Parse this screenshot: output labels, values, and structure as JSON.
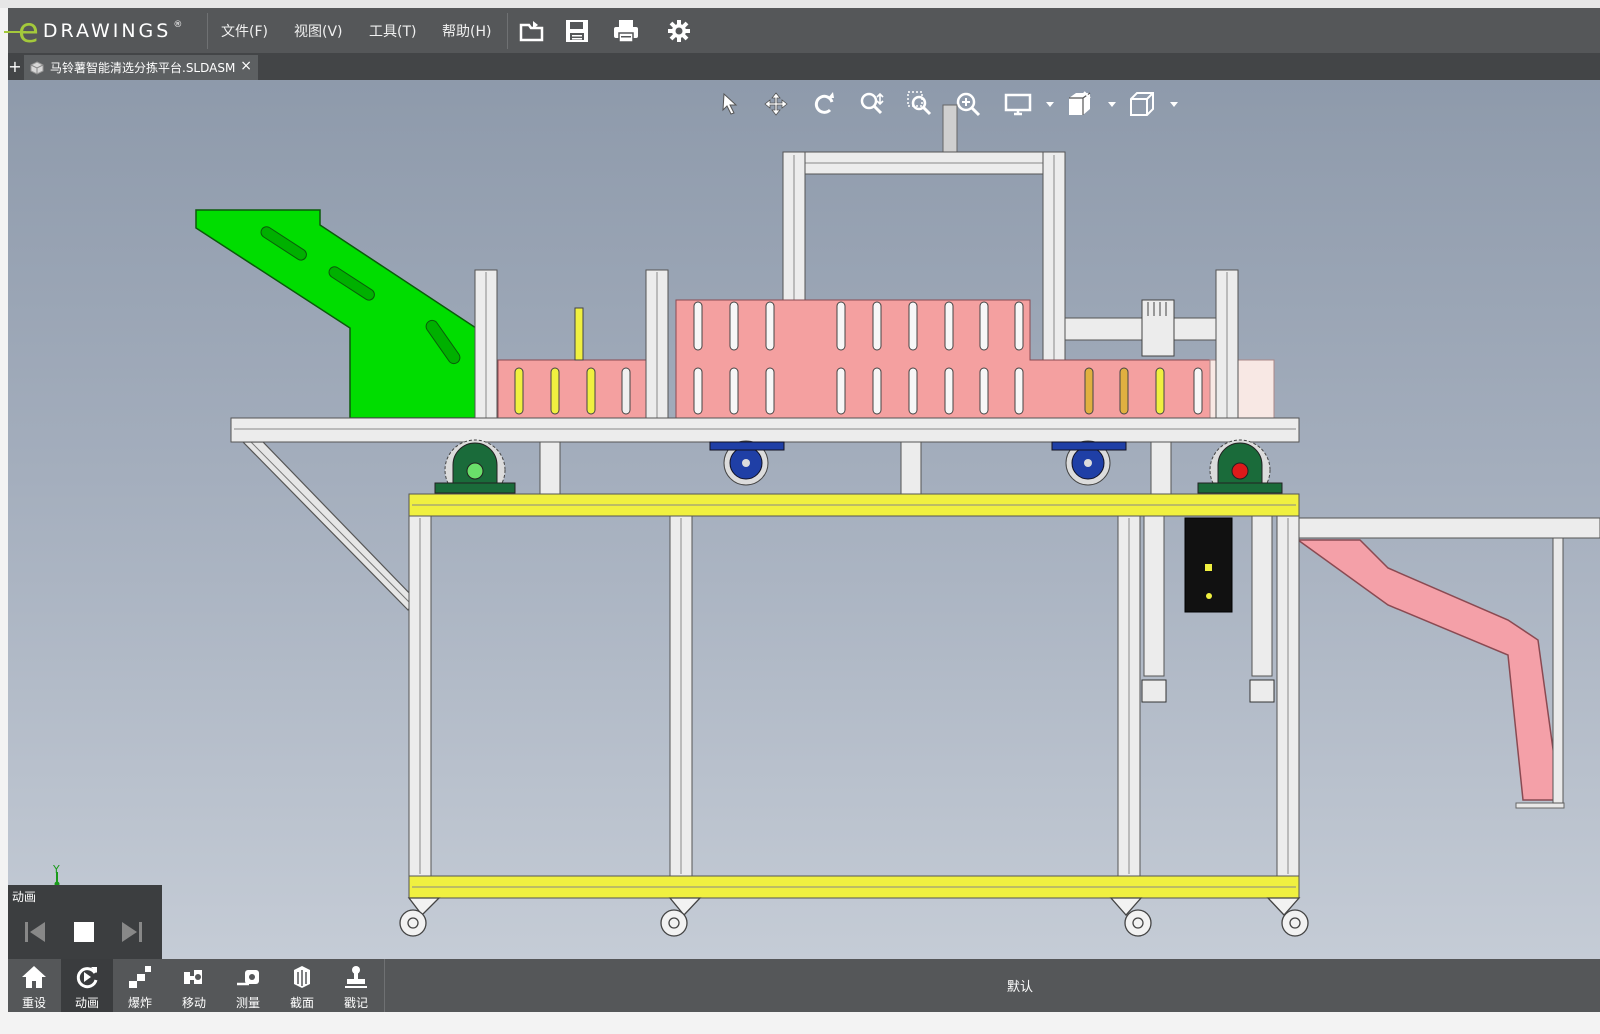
{
  "app": {
    "logo_mark": "e",
    "logo_text": "DRAWINGS",
    "registered": "®"
  },
  "menu": [
    {
      "label": "文件(F)"
    },
    {
      "label": "视图(V)"
    },
    {
      "label": "工具(T)"
    },
    {
      "label": "帮助(H)"
    }
  ],
  "toolbar": [
    "open-folder-icon",
    "save-icon",
    "print-icon",
    "settings-gear-icon"
  ],
  "tabs": [
    {
      "title": "马铃薯智能清选分拣平台.SLDASM",
      "close": "×",
      "active": true
    }
  ],
  "tab_add": "+",
  "view_tools": [
    "select-arrow-icon",
    "pan-move-icon",
    "rotate-icon",
    "zoom-fit-icon",
    "zoom-area-icon",
    "zoom-in-icon",
    "display-style-icon",
    "section-view-icon",
    "view-orientation-icon"
  ],
  "triad": {
    "y_label": "Y"
  },
  "animation_panel": {
    "title": "动画"
  },
  "bottom_tools": [
    {
      "label": "重设",
      "icon": "home-icon"
    },
    {
      "label": "动画",
      "icon": "animate-icon",
      "active": true
    },
    {
      "label": "爆炸",
      "icon": "explode-icon"
    },
    {
      "label": "移动",
      "icon": "move-icon"
    },
    {
      "label": "测量",
      "icon": "measure-icon"
    },
    {
      "label": "截面",
      "icon": "section-icon"
    },
    {
      "label": "戳记",
      "icon": "stamp-icon"
    }
  ],
  "configuration": "默认",
  "colors": {
    "chassis": "#555759",
    "hopper": "#00dd00",
    "bin": "#f4a0a0",
    "rail": "#f0f040",
    "frame": "#e8e8e8",
    "bearing": "#1a6b3a",
    "wheel": "#1f3fa6"
  }
}
